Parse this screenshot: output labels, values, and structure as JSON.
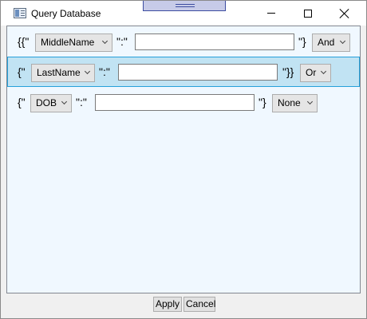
{
  "window": {
    "title": "Query Database"
  },
  "rows": [
    {
      "open_prefix": "{{\"",
      "field": "MiddleName",
      "separator": "\":\"",
      "value": "",
      "close_suffix": "\"}",
      "operator": "And",
      "selected": false
    },
    {
      "open_prefix": "{\"",
      "field": "LastName",
      "separator": "\":\"",
      "value": "",
      "close_suffix": "\"}}",
      "operator": "Or",
      "selected": true
    },
    {
      "open_prefix": "{\"",
      "field": "DOB",
      "separator": "\":\"",
      "value": "",
      "close_suffix": "\"}",
      "operator": "None",
      "selected": false
    }
  ],
  "buttons": {
    "apply": "Apply",
    "cancel": "Cancel"
  },
  "icons": {
    "app": "app-window-icon",
    "minimize": "minimize-icon",
    "maximize": "maximize-icon",
    "close": "close-icon",
    "dropdown": "chevron-down-icon",
    "drag": "drag-handle-icon"
  },
  "colors": {
    "selected_row_bg": "#c1e3f3",
    "selected_row_border": "#26a0da",
    "client_bg": "#f0f8ff"
  }
}
